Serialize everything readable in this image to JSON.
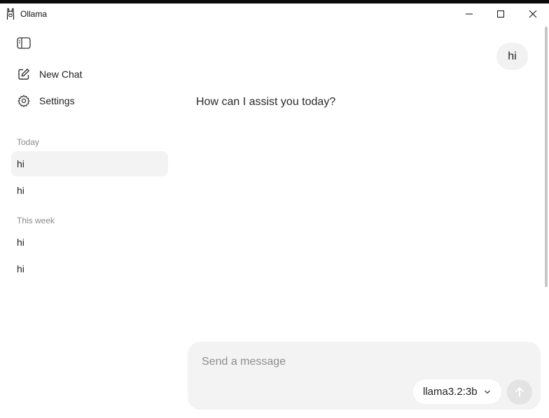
{
  "window": {
    "title": "Ollama"
  },
  "sidebar": {
    "new_chat_label": "New Chat",
    "settings_label": "Settings",
    "sections": [
      {
        "label": "Today",
        "items": [
          "hi",
          "hi"
        ]
      },
      {
        "label": "This week",
        "items": [
          "hi",
          "hi"
        ]
      }
    ],
    "active_item": "Today/0"
  },
  "conversation": {
    "user_message": "hi",
    "assistant_message": "How can I assist you today?"
  },
  "composer": {
    "placeholder": "Send a message",
    "value": "",
    "model": "llama3.2:3b"
  },
  "icons": {
    "app": "ollama-llama-icon",
    "sidebar_toggle": "sidebar-toggle-icon",
    "new_chat": "compose-icon",
    "settings": "gear-icon",
    "model_dropdown": "chevron-down-icon",
    "send": "arrow-up-icon"
  },
  "colors": {
    "sidebar_active": "#f3f3f3",
    "composer_bg": "#f3f3f3",
    "send_disabled": "#e3e3e3",
    "section_label": "#8a8a8a"
  }
}
